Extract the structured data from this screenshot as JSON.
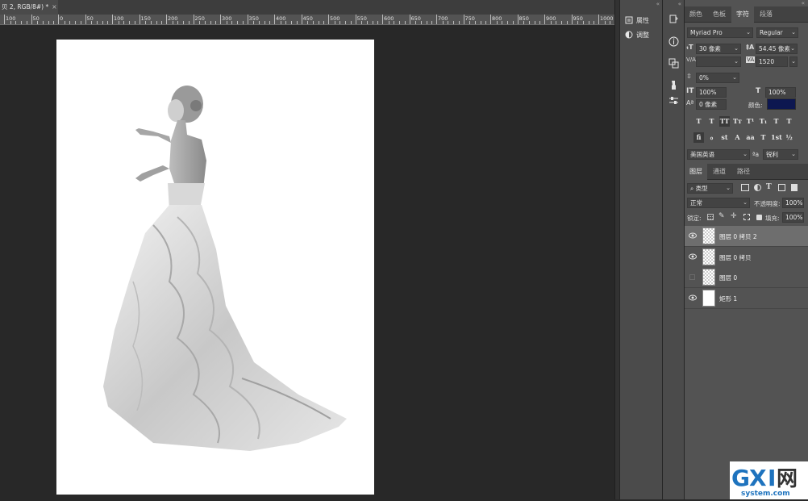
{
  "document_tab": {
    "title": "贝 2, RGB/8#) *",
    "close": "×"
  },
  "ruler": {
    "labels": [
      "100",
      "50",
      "0",
      "50",
      "100",
      "150",
      "200",
      "250",
      "300",
      "350",
      "400",
      "450",
      "500",
      "550",
      "600",
      "650",
      "700",
      "750",
      "800",
      "850",
      "900",
      "950",
      "1000"
    ]
  },
  "mini_panel": {
    "collapse": "«",
    "items": [
      {
        "label": "属性",
        "icon": "properties-icon"
      },
      {
        "label": "调整",
        "icon": "adjustments-icon"
      }
    ]
  },
  "tool_column": {
    "collapse": "«",
    "icons": [
      "history-icon",
      "info-icon",
      "navigator-icon",
      "brush-icon",
      "tool-presets-icon"
    ]
  },
  "character_panel": {
    "collapse": "«",
    "tabs": [
      "颜色",
      "色板",
      "字符",
      "段落"
    ],
    "active_tab": "字符",
    "font_family": "Myriad Pro",
    "font_style": "Regular",
    "font_size": "30 像素",
    "leading": "54.45 像素",
    "kerning": "",
    "tracking": "1520",
    "baseline_scale": "0%",
    "vertical_scale": "100%",
    "horizontal_scale": "100%",
    "baseline_shift": "0 像素",
    "color_label": "颜色:",
    "color_value": "#0d1750",
    "style_buttons": [
      "T",
      "T",
      "TT",
      "Tт",
      "T¹",
      "T₁",
      "T",
      "T"
    ],
    "opentype_buttons": [
      "fi",
      "ℴ",
      "st",
      "A",
      "aa",
      "T",
      "1st",
      "½"
    ],
    "language": "美国英语",
    "aa_label": "ªa",
    "antialias": "锐利"
  },
  "layers_panel": {
    "tabs": [
      "图层",
      "通道",
      "路径"
    ],
    "active_tab": "图层",
    "filter_kind": "类型",
    "filter_icons": [
      "pixel-filter-icon",
      "adjustment-filter-icon",
      "type-filter-icon",
      "shape-filter-icon",
      "smart-object-filter-icon"
    ],
    "blend_mode": "正常",
    "opacity_label": "不透明度:",
    "opacity": "100%",
    "lock_label": "锁定:",
    "fill_label": "填充:",
    "fill": "100%",
    "layers": [
      {
        "name": "图层 0 拷贝 2",
        "visible": true,
        "selected": true,
        "thumb": "checker"
      },
      {
        "name": "图层 0 拷贝",
        "visible": true,
        "selected": false,
        "thumb": "checker"
      },
      {
        "name": "图层 0",
        "visible": false,
        "selected": false,
        "thumb": "checker"
      },
      {
        "name": "矩形 1",
        "visible": true,
        "selected": false,
        "thumb": "white"
      }
    ]
  },
  "colors": {
    "workspace": "#282828",
    "panel": "#535353",
    "panel_dark": "#4b4b4b",
    "canvas": "#ffffff"
  }
}
